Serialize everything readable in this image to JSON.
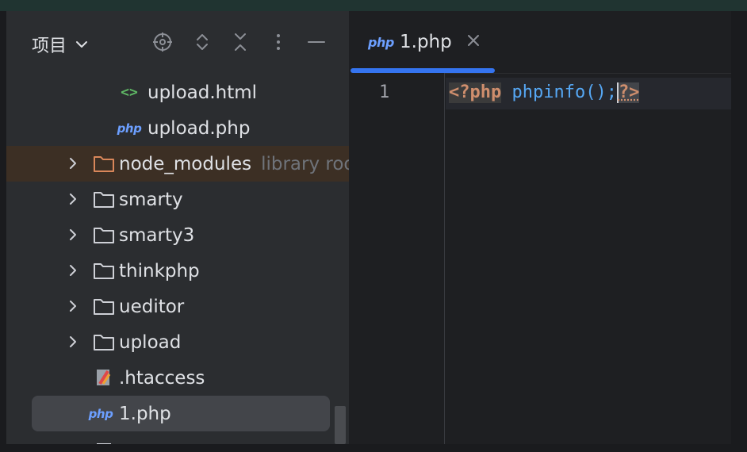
{
  "project_panel": {
    "title": "项目",
    "tree": [
      {
        "label": "upload.html",
        "icon": "html-icon",
        "badge": "<>"
      },
      {
        "label": "upload.php",
        "icon": "php-icon",
        "badge": "php"
      },
      {
        "label": "node_modules",
        "icon": "folder-icon",
        "hint": "library roo"
      },
      {
        "label": "smarty",
        "icon": "folder-icon"
      },
      {
        "label": "smarty3",
        "icon": "folder-icon"
      },
      {
        "label": "thinkphp",
        "icon": "folder-icon"
      },
      {
        "label": "ueditor",
        "icon": "folder-icon"
      },
      {
        "label": "upload",
        "icon": "folder-icon"
      },
      {
        "label": ".htaccess",
        "icon": "htaccess-icon"
      },
      {
        "label": "1.php",
        "icon": "php-icon",
        "badge": "php"
      }
    ]
  },
  "editor": {
    "tab": {
      "badge": "php",
      "label": "1.php"
    },
    "line_number": "1",
    "code": {
      "open_tag": "<?php",
      "space": " ",
      "func": "phpinfo();",
      "close_tag": "?>"
    }
  },
  "colors": {
    "accent": "#3574f0",
    "php_badge": "#6c9fff",
    "php_tag": "#cf8e6d",
    "function": "#56a8f5",
    "library_row": "#3c2f24"
  }
}
